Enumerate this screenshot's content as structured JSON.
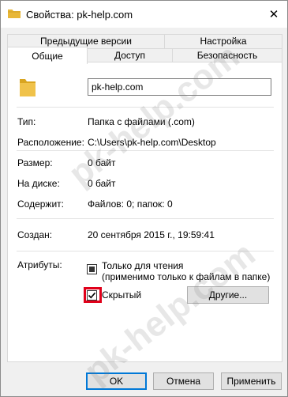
{
  "window": {
    "title": "Свойства: pk-help.com",
    "close_glyph": "✕"
  },
  "tabs": {
    "row1": [
      "Предыдущие версии",
      "Настройка"
    ],
    "row2": [
      "Общие",
      "Доступ",
      "Безопасность"
    ],
    "active": "Общие"
  },
  "general": {
    "name_value": "pk-help.com",
    "rows": [
      {
        "label": "Тип:",
        "value": "Папка с файлами (.com)"
      },
      {
        "label": "Расположение:",
        "value": "C:\\Users\\pk-help.com\\Desktop"
      },
      {
        "label": "Размер:",
        "value": "0 байт"
      },
      {
        "label": "На диске:",
        "value": "0 байт"
      },
      {
        "label": "Содержит:",
        "value": "Файлов: 0; папок: 0"
      },
      {
        "label": "Создан:",
        "value": "20 сентября 2015 г., 19:59:41"
      }
    ],
    "attributes_label": "Атрибуты:",
    "readonly_line1": "Только для чтения",
    "readonly_line2": "(применимо только к файлам в папке)",
    "readonly_state": "indeterminate",
    "hidden_label": "Скрытый",
    "hidden_checked": true,
    "other_button": "Другие..."
  },
  "footer": {
    "ok": "OK",
    "cancel": "Отмена",
    "apply": "Применить"
  },
  "colors": {
    "highlight_frame": "#e0001a",
    "folder": "#e8b738",
    "default_button_border": "#0078d7"
  },
  "icons": {
    "title": "folder-icon",
    "close": "close-icon",
    "main": "folder-icon"
  },
  "watermark": "pk-help.com"
}
